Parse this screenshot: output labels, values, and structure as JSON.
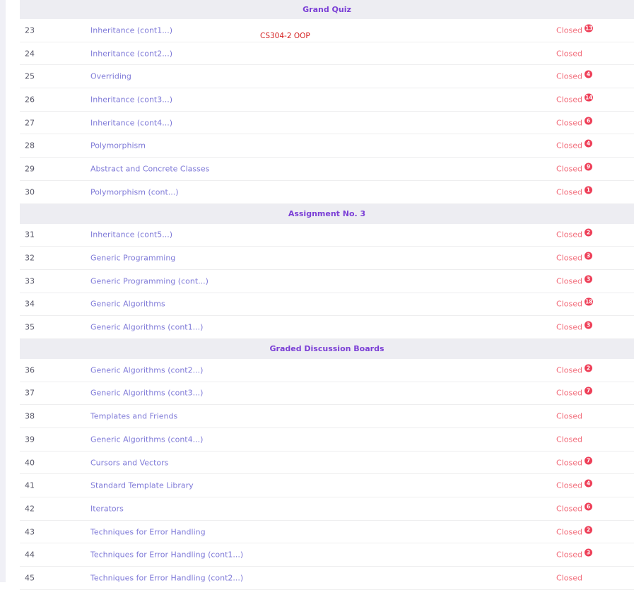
{
  "course_tag": "CS304-2 OOP",
  "sections": [
    {
      "heading": "Grand Quiz",
      "rows": [
        {
          "num": "23",
          "title": "Inheritance (cont1...)",
          "status": "Closed",
          "badge": "13"
        },
        {
          "num": "24",
          "title": "Inheritance (cont2...)",
          "status": "Closed",
          "badge": ""
        },
        {
          "num": "25",
          "title": "Overriding",
          "status": "Closed",
          "badge": "4"
        },
        {
          "num": "26",
          "title": "Inheritance (cont3...)",
          "status": "Closed",
          "badge": "14"
        },
        {
          "num": "27",
          "title": "Inheritance (cont4...)",
          "status": "Closed",
          "badge": "6"
        },
        {
          "num": "28",
          "title": "Polymorphism",
          "status": "Closed",
          "badge": "4"
        },
        {
          "num": "29",
          "title": "Abstract and Concrete Classes",
          "status": "Closed",
          "badge": "9"
        },
        {
          "num": "30",
          "title": "Polymorphism (cont...)",
          "status": "Closed",
          "badge": "1"
        }
      ]
    },
    {
      "heading": "Assignment No. 3",
      "rows": [
        {
          "num": "31",
          "title": "Inheritance (cont5...)",
          "status": "Closed",
          "badge": "2"
        },
        {
          "num": "32",
          "title": "Generic Programming",
          "status": "Closed",
          "badge": "3"
        },
        {
          "num": "33",
          "title": "Generic Programming (cont...)",
          "status": "Closed",
          "badge": "3"
        },
        {
          "num": "34",
          "title": "Generic Algorithms",
          "status": "Closed",
          "badge": "18"
        },
        {
          "num": "35",
          "title": "Generic Algorithms (cont1...)",
          "status": "Closed",
          "badge": "3"
        }
      ]
    },
    {
      "heading": "Graded Discussion Boards",
      "rows": [
        {
          "num": "36",
          "title": "Generic Algorithms (cont2...)",
          "status": "Closed",
          "badge": "2"
        },
        {
          "num": "37",
          "title": "Generic Algorithms (cont3...)",
          "status": "Closed",
          "badge": "7"
        },
        {
          "num": "38",
          "title": "Templates and Friends",
          "status": "Closed",
          "badge": ""
        },
        {
          "num": "39",
          "title": "Generic Algorithms (cont4...)",
          "status": "Closed",
          "badge": ""
        },
        {
          "num": "40",
          "title": "Cursors and Vectors",
          "status": "Closed",
          "badge": "7"
        },
        {
          "num": "41",
          "title": "Standard Template Library",
          "status": "Closed",
          "badge": "4"
        },
        {
          "num": "42",
          "title": "Iterators",
          "status": "Closed",
          "badge": "6"
        },
        {
          "num": "43",
          "title": "Techniques for Error Handling",
          "status": "Closed",
          "badge": "2"
        },
        {
          "num": "44",
          "title": "Techniques for Error Handling (cont1...)",
          "status": "Closed",
          "badge": "3"
        },
        {
          "num": "45",
          "title": "Techniques for Error Handling (cont2...)",
          "status": "Closed",
          "badge": ""
        }
      ]
    }
  ]
}
